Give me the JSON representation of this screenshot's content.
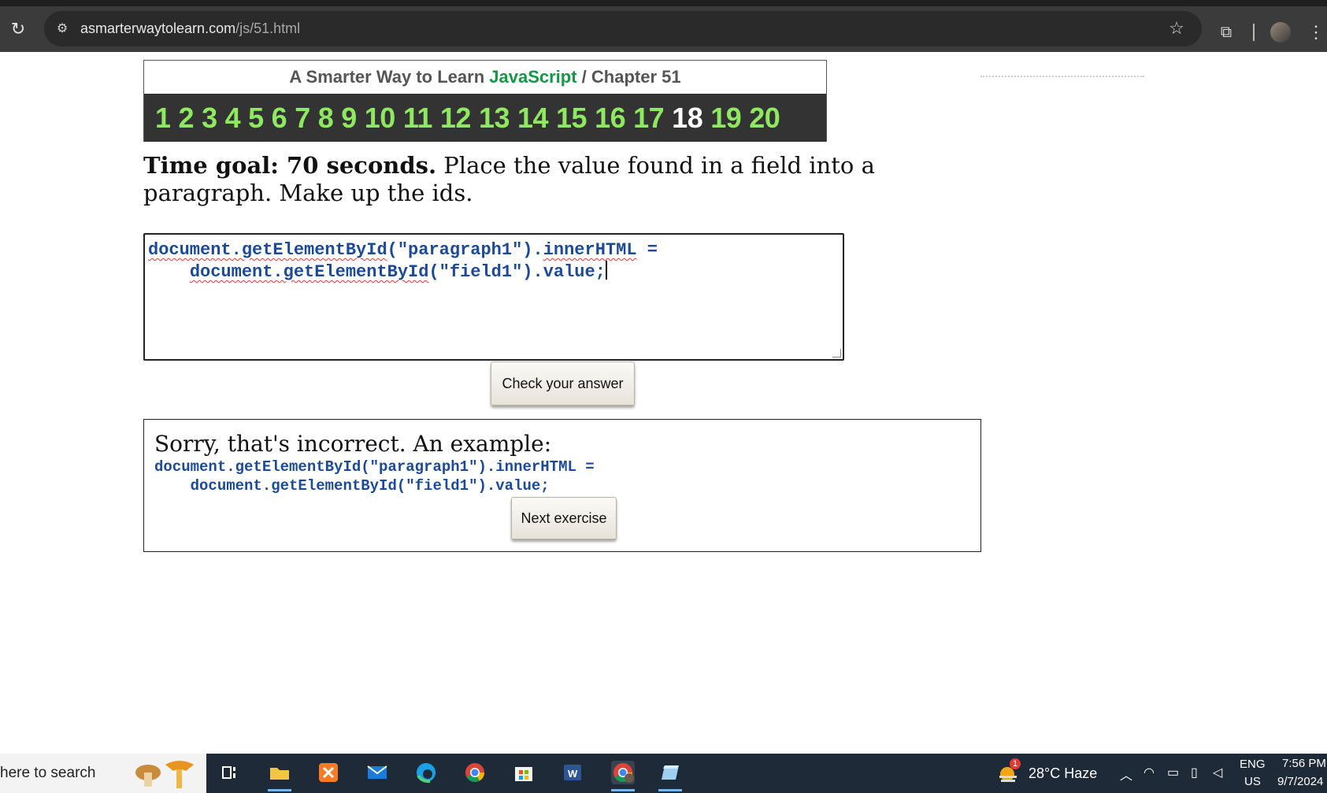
{
  "browser": {
    "url_host": "asmarterwaytolearn.com",
    "url_path": "/js/51.html",
    "icons": [
      "reload-icon",
      "site-info-icon",
      "star-icon",
      "extensions-icon",
      "avatar",
      "menu-icon"
    ]
  },
  "header": {
    "title_prefix": "A Smarter Way to Learn ",
    "title_js": "JavaScript",
    "title_sep": " / ",
    "title_chapter": "Chapter 51",
    "chapters": [
      "1",
      "2",
      "3",
      "4",
      "5",
      "6",
      "7",
      "8",
      "9",
      "10",
      "11",
      "12",
      "13",
      "14",
      "15",
      "16",
      "17",
      "18",
      "19",
      "20"
    ],
    "current_chapter": "18"
  },
  "instruction": {
    "goal": "Time goal: 70 seconds.",
    "text": " Place the value found in a field into a paragraph. Make up the ids."
  },
  "answer": {
    "line1_a": "document.getElementById",
    "line1_b": "(\"paragraph1\").",
    "line1_c": "innerHTML",
    "line1_d": " =",
    "line2_indent": "    ",
    "line2_a": "document.getElementById",
    "line2_b": "(\"field1\").value;"
  },
  "check_button": "Check your answer",
  "result": {
    "message": "Sorry, that's incorrect. An example:",
    "example_line1": "document.getElementById(\"paragraph1\").innerHTML =",
    "example_line2": "    document.getElementById(\"field1\").value;",
    "next_button": "Next exercise"
  },
  "taskbar": {
    "search_text": "here to search",
    "weather": "28°C  Haze",
    "lang_top": "ENG",
    "lang_bottom": "US",
    "time": "7:56 PM",
    "date": "9/7/2024",
    "weather_badge": "1"
  }
}
